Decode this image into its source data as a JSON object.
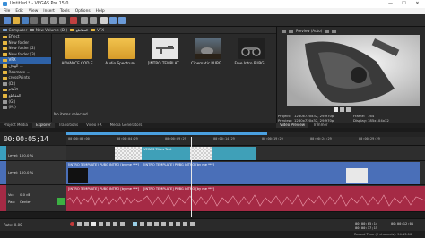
{
  "window": {
    "title": "Untitled * - VEGAS Pro 15.0",
    "controls": [
      "—",
      "☐",
      "✕"
    ]
  },
  "menu": [
    "File",
    "Edit",
    "View",
    "Insert",
    "Tools",
    "Options",
    "Help"
  ],
  "explorer": {
    "breadcrumbs": [
      "Computer",
      "New Volume (D:)",
      "المقاطع",
      "VFX"
    ],
    "tree": [
      {
        "label": "Effect",
        "selected": false
      },
      {
        "label": "New folder",
        "selected": false
      },
      {
        "label": "New folder (2)",
        "selected": false
      },
      {
        "label": "New folder (3)",
        "selected": false
      },
      {
        "label": "VFX",
        "selected": true
      },
      {
        "label": "الهدف ...",
        "selected": false
      },
      {
        "label": "Roomate ...",
        "selected": false
      },
      {
        "label": "crossPoints",
        "selected": false
      },
      {
        "label": "(D:)",
        "selected": false
      },
      {
        "label": "الأفلام",
        "selected": false
      },
      {
        "label": "المقاطع",
        "selected": false
      },
      {
        "label": "(G:)",
        "selected": false
      },
      {
        "label": "(M:)",
        "selected": false
      }
    ],
    "files": [
      {
        "label": "ADVANCE COD E...",
        "kind": "folder"
      },
      {
        "label": "Audio Spectrum...",
        "kind": "folder"
      },
      {
        "label": "[INTRO TEMPLAT...",
        "kind": "video-gun"
      },
      {
        "label": "Cinematic PUBG...",
        "kind": "video-desert"
      },
      {
        "label": "Free Intro PUBG...",
        "kind": "video-bike"
      }
    ],
    "status": "No items selected",
    "tabs": [
      "Project Media",
      "Explorer",
      "Transitions",
      "Video FX",
      "Media Generators"
    ],
    "active_tab": "Explorer"
  },
  "preview": {
    "mode": "Preview (Auto)",
    "info": {
      "project_label": "Project:",
      "project_value": "1280x720x32, 29.970p",
      "preview_label": "Preview:",
      "preview_value": "1280x720x32, 29.970p",
      "display_label": "Display:",
      "display_value": "185x104x32",
      "frame_label": "Frame:",
      "frame_value": "164"
    },
    "tabs": [
      "Video Preview",
      "Trimmer"
    ],
    "active_tab": "Video Preview"
  },
  "timeline": {
    "timecode": "00:00:05;14",
    "ruler": [
      "00:00:00;00",
      "00:00:04;29",
      "00:00:09;29",
      "00:00:14;29",
      "00:00:19;29",
      "00:00:24;29",
      "00:00:29;29"
    ],
    "tracks": [
      {
        "type": "video",
        "level_label": "Level: 100.0 %",
        "color": "#3a9fbf"
      },
      {
        "type": "video",
        "level_label": "Level: 100.0 %",
        "color": "#4a6fb8"
      },
      {
        "type": "audio",
        "vol_label": "Vol:",
        "vol_value": "0.0 dB",
        "pan_label": "Pan:",
        "pan_value": "Center",
        "color": "#b0304a"
      }
    ],
    "clips": [
      {
        "track": 0,
        "label": "VEGAS Titles Text"
      },
      {
        "track": 1,
        "label": "[INTRO TEMPLATE] PUBG INTRO [by me ***]"
      },
      {
        "track": 1,
        "label": "[INTRO TEMPLATE] PUBG INTRO [by me ***]"
      },
      {
        "track": 2,
        "label": "[INTRO TEMPLATE] PUBG INTRO [by me ***]"
      },
      {
        "track": 2,
        "label": "[INTRO TEMPLATE] PUBG INTRO [by me ***]"
      }
    ]
  },
  "transport": {
    "rate_label": "Rate: 0.00",
    "position": "00:00:05;14",
    "end": "00:00:17;15",
    "duration": "00:00:12;01"
  },
  "statusbar": {
    "text": "Record Time (2 channels): 94:13:10"
  },
  "colors": {
    "accent": "#3a8fd8",
    "video_track": "#4a6fb8",
    "title_clip": "#3fa0b8",
    "audio_track": "#a52a45"
  }
}
